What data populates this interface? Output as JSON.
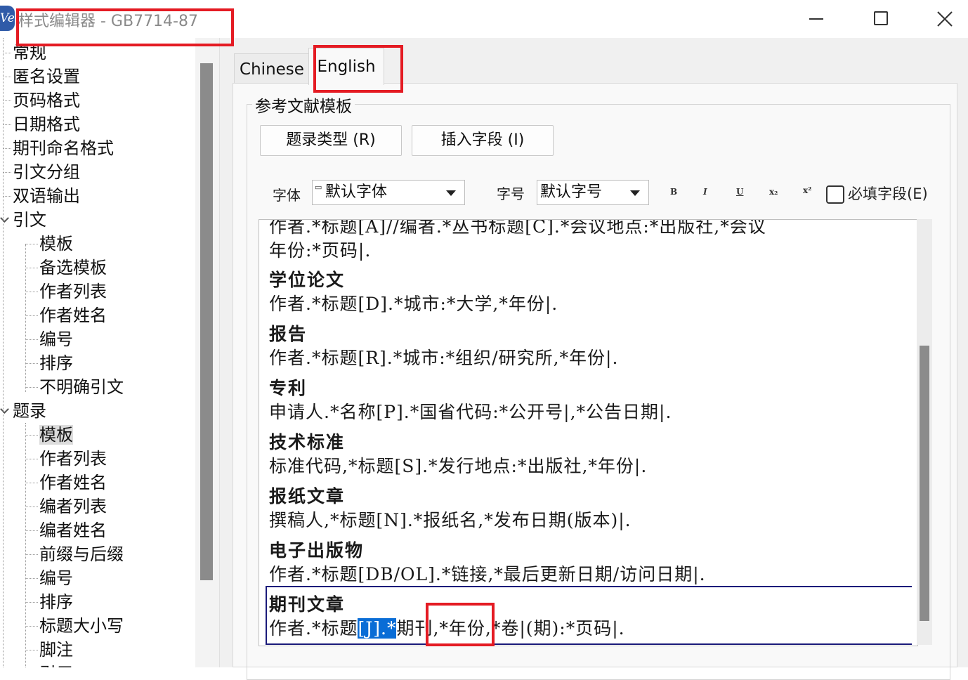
{
  "window": {
    "title": "样式编辑器 - GB7714-87",
    "icon": "Ve"
  },
  "tree": {
    "items": [
      {
        "label": "常规",
        "level": 0
      },
      {
        "label": "匿名设置",
        "level": 0
      },
      {
        "label": "页码格式",
        "level": 0
      },
      {
        "label": "日期格式",
        "level": 0
      },
      {
        "label": "期刊命名格式",
        "level": 0
      },
      {
        "label": "引文分组",
        "level": 0
      },
      {
        "label": "双语输出",
        "level": 0
      },
      {
        "label": "引文",
        "level": 0,
        "expanded": true
      },
      {
        "label": "模板",
        "level": 1
      },
      {
        "label": "备选模板",
        "level": 1
      },
      {
        "label": "作者列表",
        "level": 1
      },
      {
        "label": "作者姓名",
        "level": 1
      },
      {
        "label": "编号",
        "level": 1
      },
      {
        "label": "排序",
        "level": 1
      },
      {
        "label": "不明确引文",
        "level": 1
      },
      {
        "label": "题录",
        "level": 0,
        "expanded": true
      },
      {
        "label": "模板",
        "level": 1,
        "selected": true
      },
      {
        "label": "作者列表",
        "level": 1
      },
      {
        "label": "作者姓名",
        "level": 1
      },
      {
        "label": "编者列表",
        "level": 1
      },
      {
        "label": "编者姓名",
        "level": 1
      },
      {
        "label": "前缀与后缀",
        "level": 1
      },
      {
        "label": "编号",
        "level": 1
      },
      {
        "label": "排序",
        "level": 1
      },
      {
        "label": "标题大小写",
        "level": 1
      },
      {
        "label": "脚注",
        "level": 1
      },
      {
        "label": "引用",
        "level": 1
      }
    ]
  },
  "tabs": {
    "chinese": "Chinese",
    "english": "English",
    "active": "English"
  },
  "template": {
    "group_label": "参考文献模板",
    "ref_type_button": "题录类型 (R)",
    "insert_field_button": "插入字段 (I)",
    "font_label": "字体",
    "font_value": "默认字体",
    "size_label": "字号",
    "size_value": "默认字号",
    "format_buttons": [
      "B",
      "I",
      "U",
      "x₂",
      "x²"
    ],
    "required_label": "必填字段(E)"
  },
  "editor": {
    "lines": [
      {
        "text": "作者.*标题[A]//编者.*丛书标题[C].*会议地点:*出版社,*会议",
        "type": "body"
      },
      {
        "text": "年份:*页码|.",
        "type": "body"
      },
      {
        "text": "学位论文",
        "type": "head"
      },
      {
        "text": "作者.*标题[D].*城市:*大学,*年份|.",
        "type": "body"
      },
      {
        "text": "报告",
        "type": "head"
      },
      {
        "text": "作者.*标题[R].*城市:*组织/研究所,*年份|.",
        "type": "body"
      },
      {
        "text": "专利",
        "type": "head"
      },
      {
        "text": "申请人.*名称[P].*国省代码:*公开号|,*公告日期|.",
        "type": "body"
      },
      {
        "text": "技术标准",
        "type": "head"
      },
      {
        "text": "标准代码,*标题[S].*发行地点:*出版社,*年份|.",
        "type": "body"
      },
      {
        "text": "报纸文章",
        "type": "head"
      },
      {
        "text": "撰稿人,*标题[N].*报纸名,*发布日期(版本)|.",
        "type": "body"
      },
      {
        "text": "电子出版物",
        "type": "head"
      },
      {
        "text": "作者.*标题[DB/OL].*链接,*最后更新日期/访问日期|.",
        "type": "body"
      },
      {
        "text": "期刊文章",
        "type": "head"
      }
    ],
    "last_line": {
      "part1": "作者.*标题",
      "selected": "[J].",
      "part2": "*",
      "part3": "期刊,",
      "part4": "*年份,*卷|(期):*页码|."
    }
  },
  "colors": {
    "annotation": "#e41b23",
    "selection": "#0a6dd6"
  }
}
